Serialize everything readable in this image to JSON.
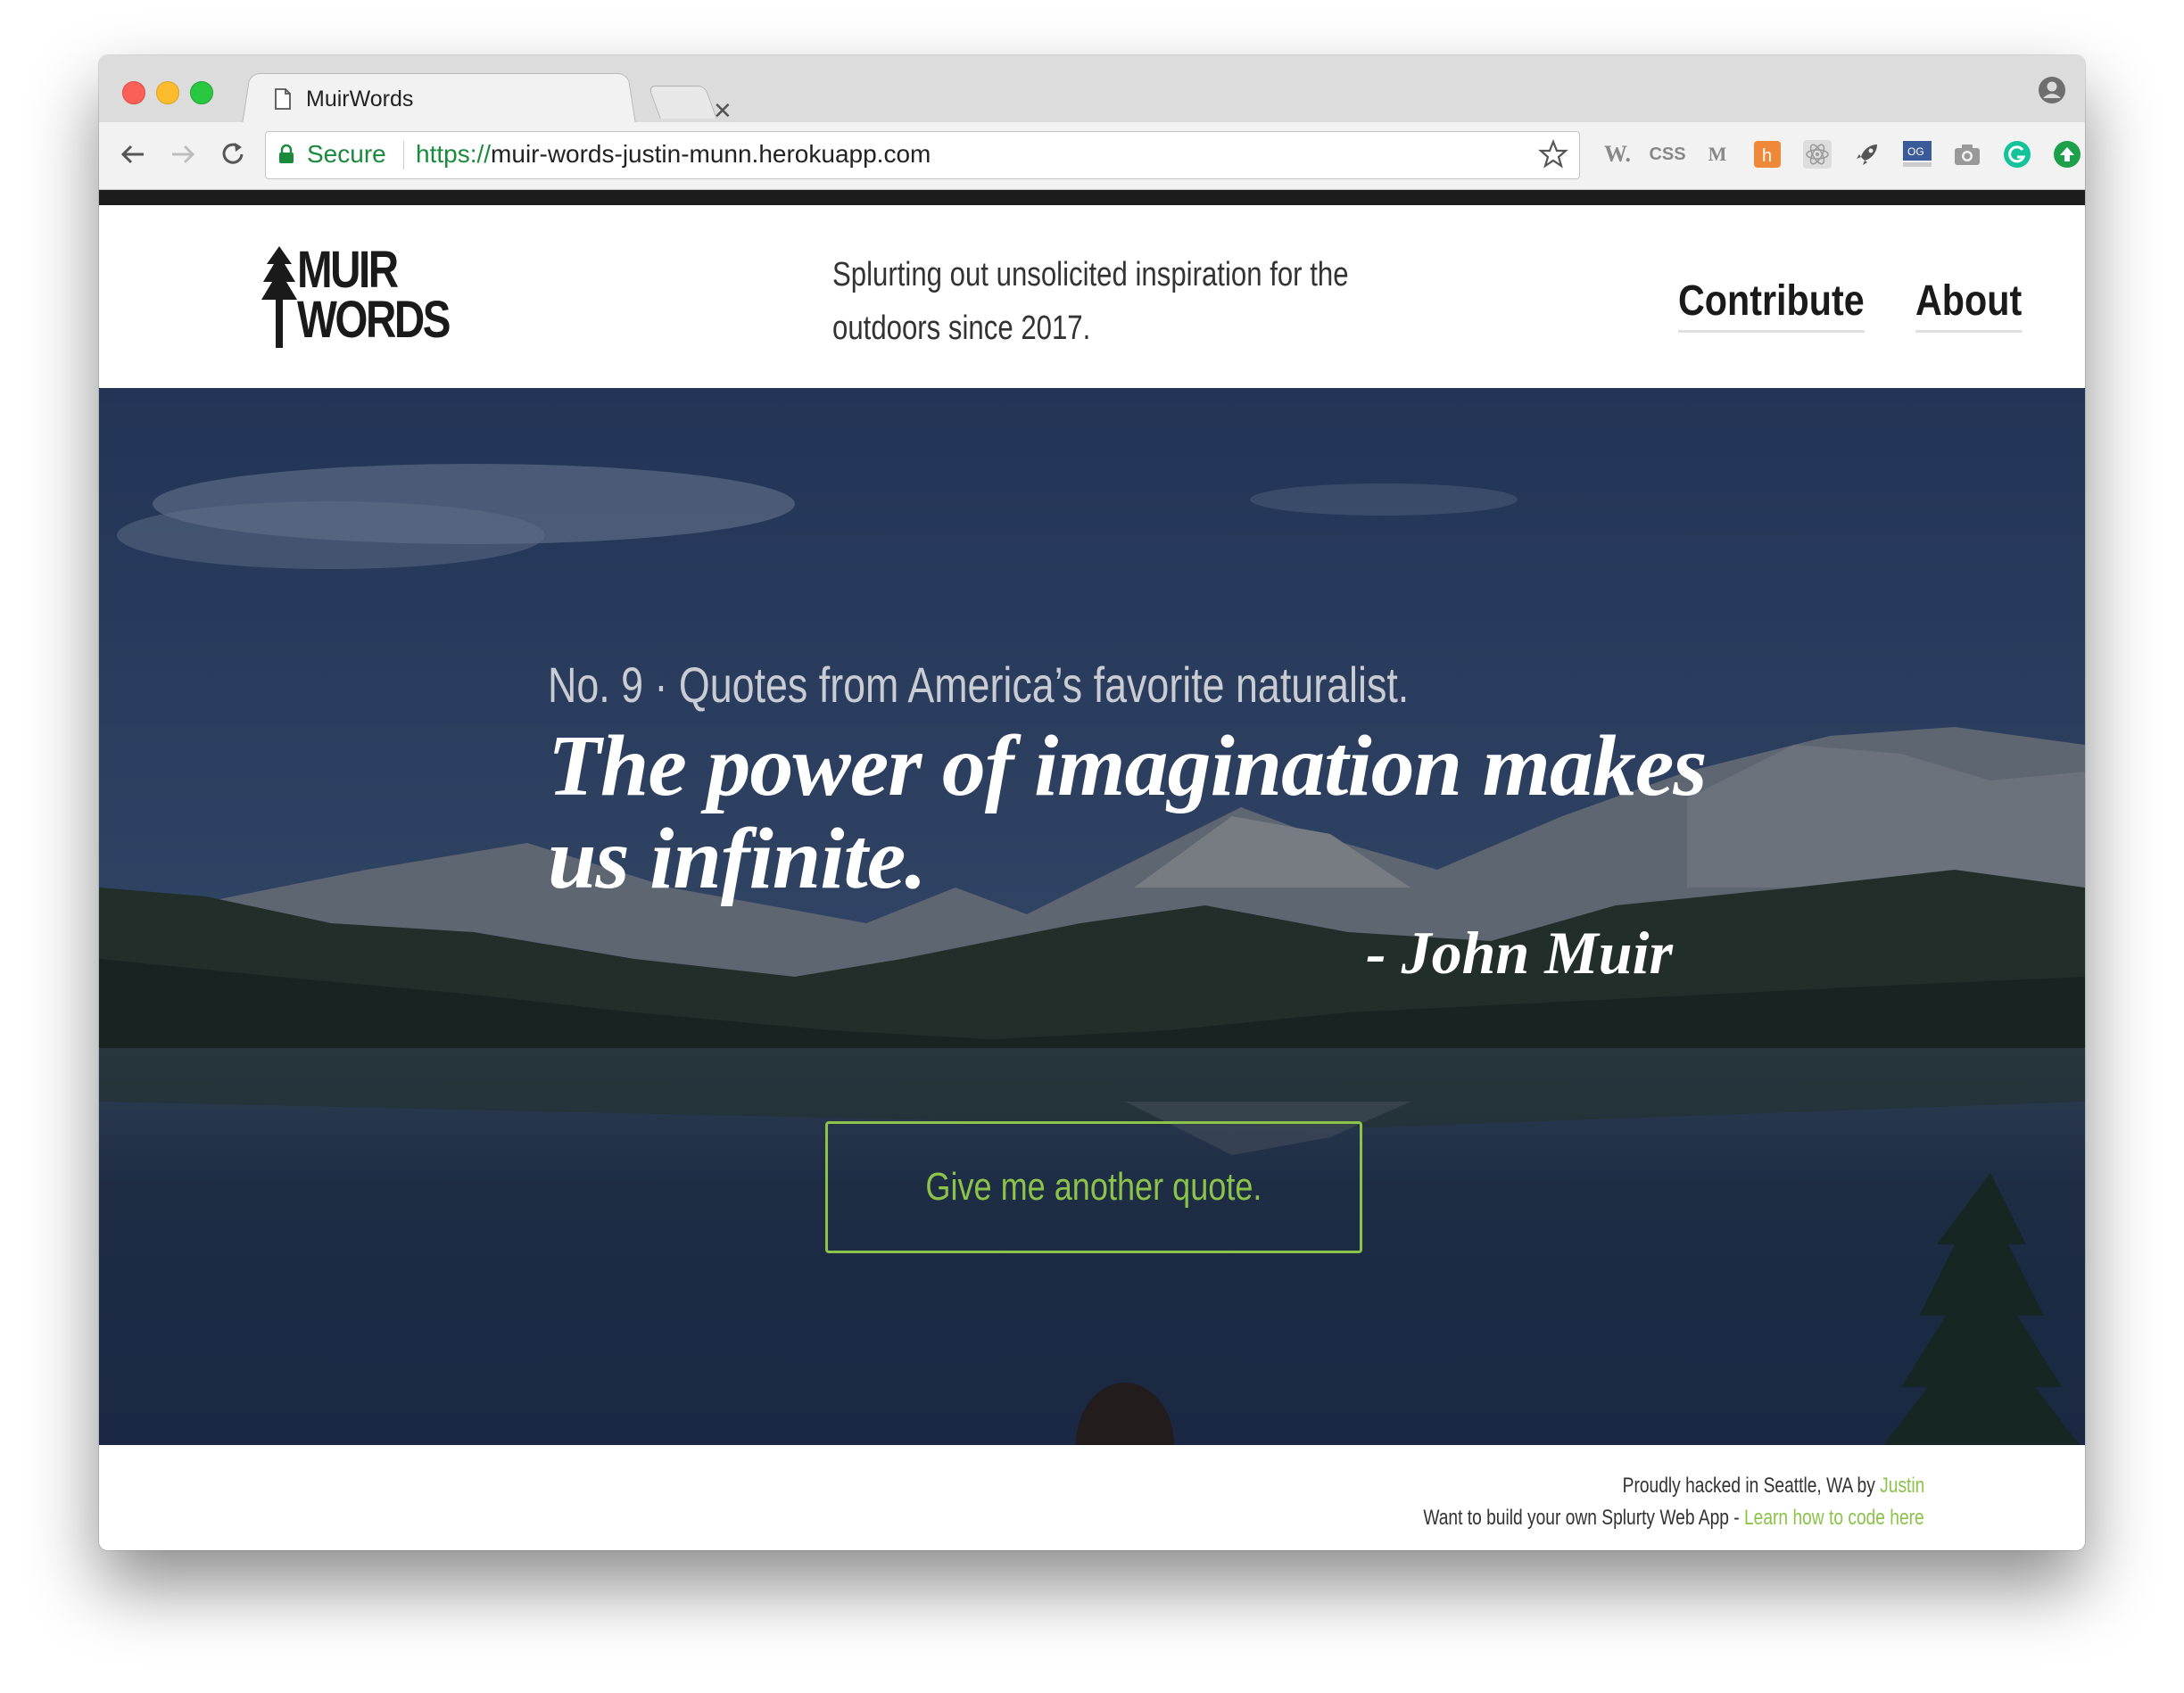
{
  "browser": {
    "tab_title": "MuirWords",
    "secure_label": "Secure",
    "url_scheme": "https://",
    "url_host": "muir-words-justin-munn.herokuapp.com",
    "extensions": [
      "W.",
      "CSS",
      "M",
      "h-icon",
      "react-icon",
      "rocket-icon",
      "OG",
      "camera-icon",
      "grammarly-icon",
      "upload-icon"
    ]
  },
  "header": {
    "logo_line1": "MUIR",
    "logo_line2": "WORDS",
    "tagline": "Splurting out unsolicited inspiration for the outdoors since 2017.",
    "nav": [
      "Contribute",
      "About"
    ]
  },
  "hero": {
    "subhead": "No. 9 · Quotes from America’s favorite naturalist.",
    "quote": "The power of imagination makes us infinite.",
    "author": "- John Muir",
    "button_label": "Give me another quote."
  },
  "footer": {
    "line1_text": "Proudly hacked in Seattle, WA by ",
    "line1_link": "Justin",
    "line2_text": "Want to build your own Splurty Web App - ",
    "line2_link": "Learn how to code here"
  },
  "colors": {
    "accent": "#8cc34a",
    "secure_green": "#1a8a3c",
    "header_bar": "#1c1c1c"
  }
}
